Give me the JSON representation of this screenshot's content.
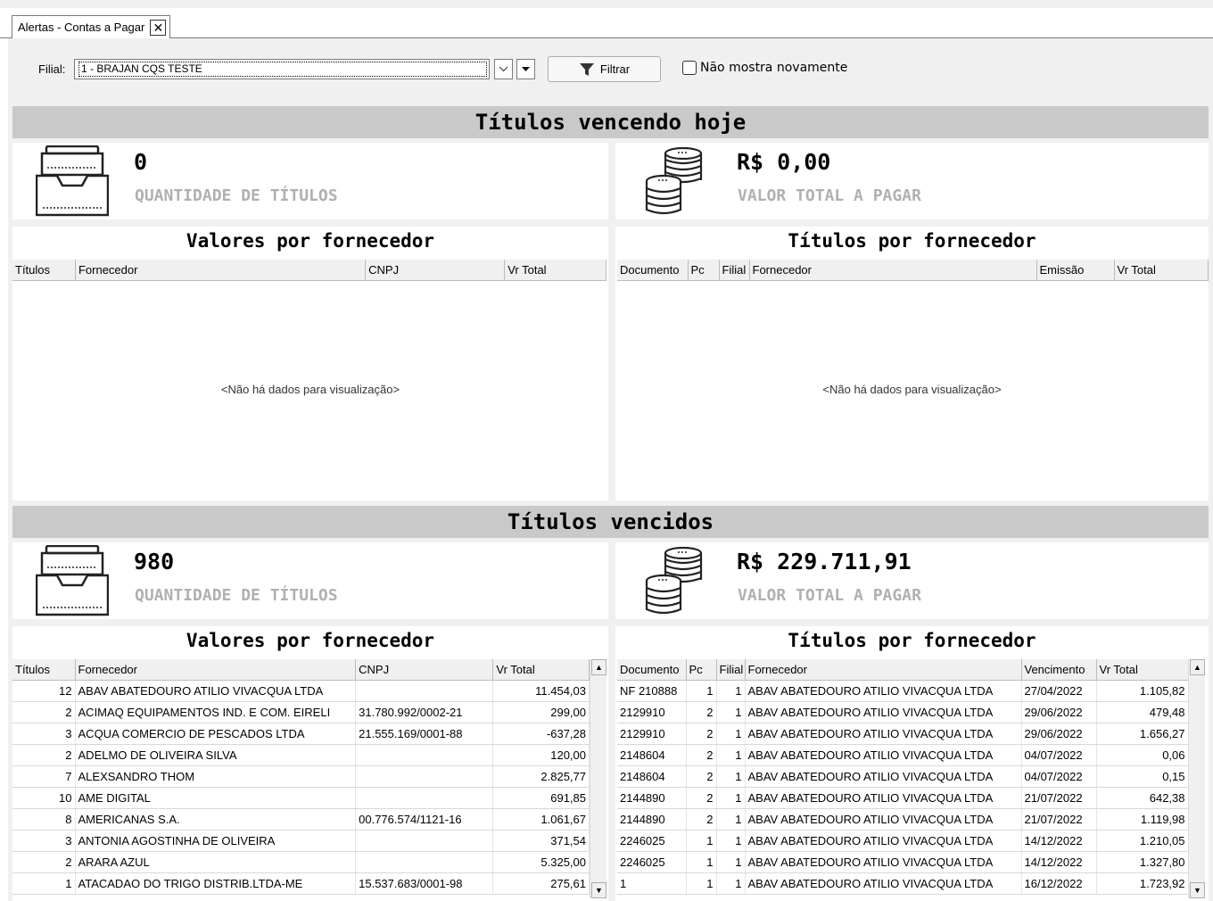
{
  "tab": {
    "title": "Alertas - Contas a Pagar",
    "close": "✕"
  },
  "toolbar": {
    "filial_label": "Filial:",
    "filial_value": "1 - BRAJAN CQS TESTE",
    "filter_label": "Filtrar",
    "checkbox_label": "Não mostra novamente"
  },
  "today": {
    "header": "Títulos vencendo hoje",
    "count": "0",
    "count_label": "QUANTIDADE DE TÍTULOS",
    "total": "R$ 0,00",
    "total_label": "VALOR TOTAL A PAGAR",
    "values_title": "Valores por fornecedor",
    "values_columns": [
      "Títulos",
      "Fornecedor",
      "CNPJ",
      "Vr Total"
    ],
    "titles_title": "Títulos por fornecedor",
    "titles_columns": [
      "Documento",
      "Pc",
      "Filial",
      "Fornecedor",
      "Emissão",
      "Vr Total"
    ],
    "empty_message": "<Não há dados para visualização>"
  },
  "overdue": {
    "header": "Títulos vencidos",
    "count": "980",
    "count_label": "QUANTIDADE DE TÍTULOS",
    "total": "R$ 229.711,91",
    "total_label": "VALOR TOTAL A PAGAR",
    "values_title": "Valores por fornecedor",
    "values_columns": [
      "Títulos",
      "Fornecedor",
      "CNPJ",
      "Vr Total"
    ],
    "values_rows": [
      [
        "12",
        "ABAV ABATEDOURO ATILIO VIVACQUA LTDA",
        "",
        "11.454,03"
      ],
      [
        "2",
        "ACIMAQ EQUIPAMENTOS IND. E COM. EIRELI",
        "31.780.992/0002-21",
        "299,00"
      ],
      [
        "3",
        "ACQUA COMERCIO DE PESCADOS LTDA",
        "21.555.169/0001-88",
        "-637,28"
      ],
      [
        "2",
        "ADELMO DE OLIVEIRA SILVA",
        "",
        "120,00"
      ],
      [
        "7",
        "ALEXSANDRO THOM",
        "",
        "2.825,77"
      ],
      [
        "10",
        "AME DIGITAL",
        "",
        "691,85"
      ],
      [
        "8",
        "AMERICANAS S.A.",
        "00.776.574/1121-16",
        "1.061,67"
      ],
      [
        "3",
        "ANTONIA AGOSTINHA DE OLIVEIRA",
        "",
        "371,54"
      ],
      [
        "2",
        "ARARA AZUL",
        "",
        "5.325,00"
      ],
      [
        "1",
        "ATACADAO DO TRIGO DISTRIB.LTDA-ME",
        "15.537.683/0001-98",
        "275,61"
      ]
    ],
    "titles_title": "Títulos por fornecedor",
    "titles_columns": [
      "Documento",
      "Pc",
      "Filial",
      "Fornecedor",
      "Vencimento",
      "Vr Total"
    ],
    "titles_rows": [
      [
        "NF 210888",
        "1",
        "1",
        "ABAV ABATEDOURO ATILIO VIVACQUA LTDA",
        "27/04/2022",
        "1.105,82"
      ],
      [
        "2129910",
        "2",
        "1",
        "ABAV ABATEDOURO ATILIO VIVACQUA LTDA",
        "29/06/2022",
        "479,48"
      ],
      [
        "2129910",
        "2",
        "1",
        "ABAV ABATEDOURO ATILIO VIVACQUA LTDA",
        "29/06/2022",
        "1.656,27"
      ],
      [
        "2148604",
        "2",
        "1",
        "ABAV ABATEDOURO ATILIO VIVACQUA LTDA",
        "04/07/2022",
        "0,06"
      ],
      [
        "2148604",
        "2",
        "1",
        "ABAV ABATEDOURO ATILIO VIVACQUA LTDA",
        "04/07/2022",
        "0,15"
      ],
      [
        "2144890",
        "2",
        "1",
        "ABAV ABATEDOURO ATILIO VIVACQUA LTDA",
        "21/07/2022",
        "642,38"
      ],
      [
        "2144890",
        "2",
        "1",
        "ABAV ABATEDOURO ATILIO VIVACQUA LTDA",
        "21/07/2022",
        "1.119,98"
      ],
      [
        "2246025",
        "1",
        "1",
        "ABAV ABATEDOURO ATILIO VIVACQUA LTDA",
        "14/12/2022",
        "1.210,05"
      ],
      [
        "2246025",
        "1",
        "1",
        "ABAV ABATEDOURO ATILIO VIVACQUA LTDA",
        "14/12/2022",
        "1.327,80"
      ],
      [
        "1",
        "1",
        "1",
        "ABAV ABATEDOURO ATILIO VIVACQUA LTDA",
        "16/12/2022",
        "1.723,92"
      ]
    ]
  },
  "icons": [
    "tray-icon",
    "coins-icon",
    "funnel-icon",
    "chevron-down-icon",
    "caret-down-icon",
    "scroll-up-icon",
    "scroll-down-icon"
  ]
}
